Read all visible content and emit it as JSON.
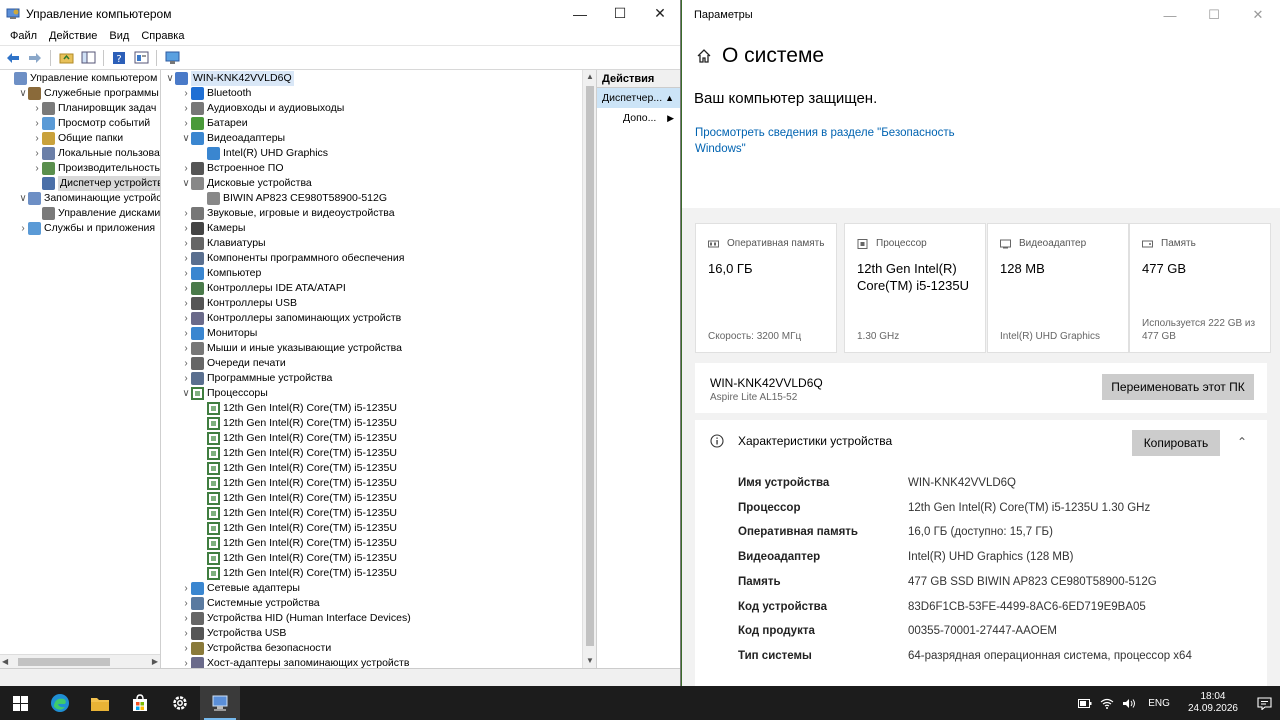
{
  "cm": {
    "title": "Управление компьютером",
    "menu": [
      "Файл",
      "Действие",
      "Вид",
      "Справка"
    ],
    "tree": [
      {
        "label": "Управление компьютером (лс",
        "level": 0,
        "tw": "",
        "sel": false
      },
      {
        "label": "Служебные программы",
        "level": 1,
        "tw": "v",
        "sel": false
      },
      {
        "label": "Планировщик задач",
        "level": 2,
        "tw": ">",
        "sel": false
      },
      {
        "label": "Просмотр событий",
        "level": 2,
        "tw": ">",
        "sel": false
      },
      {
        "label": "Общие папки",
        "level": 2,
        "tw": ">",
        "sel": false
      },
      {
        "label": "Локальные пользовате",
        "level": 2,
        "tw": ">",
        "sel": false
      },
      {
        "label": "Производительность",
        "level": 2,
        "tw": ">",
        "sel": false
      },
      {
        "label": "Диспетчер устройств",
        "level": 2,
        "tw": "",
        "sel": true
      },
      {
        "label": "Запоминающие устройств",
        "level": 1,
        "tw": "v",
        "sel": false
      },
      {
        "label": "Управление дисками",
        "level": 2,
        "tw": "",
        "sel": false
      },
      {
        "label": "Службы и приложения",
        "level": 1,
        "tw": ">",
        "sel": false
      }
    ],
    "devices": [
      {
        "label": "WIN-KNK42VVLD6Q",
        "level": 0,
        "tw": "v",
        "icon": "computer"
      },
      {
        "label": "Bluetooth",
        "level": 1,
        "tw": ">",
        "icon": "bluetooth"
      },
      {
        "label": "Аудиовходы и аудиовыходы",
        "level": 1,
        "tw": ">",
        "icon": "speaker"
      },
      {
        "label": "Батареи",
        "level": 1,
        "tw": ">",
        "icon": "battery"
      },
      {
        "label": "Видеоадаптеры",
        "level": 1,
        "tw": "v",
        "icon": "display"
      },
      {
        "label": "Intel(R) UHD Graphics",
        "level": 2,
        "tw": "",
        "icon": "display"
      },
      {
        "label": "Встроенное ПО",
        "level": 1,
        "tw": ">",
        "icon": "chip"
      },
      {
        "label": "Дисковые устройства",
        "level": 1,
        "tw": "v",
        "icon": "disk"
      },
      {
        "label": "BIWIN AP823 CE980T58900-512G",
        "level": 2,
        "tw": "",
        "icon": "disk"
      },
      {
        "label": "Звуковые, игровые и видеоустройства",
        "level": 1,
        "tw": ">",
        "icon": "speaker"
      },
      {
        "label": "Камеры",
        "level": 1,
        "tw": ">",
        "icon": "camera"
      },
      {
        "label": "Клавиатуры",
        "level": 1,
        "tw": ">",
        "icon": "keyboard"
      },
      {
        "label": "Компоненты программного обеспечения",
        "level": 1,
        "tw": ">",
        "icon": "component"
      },
      {
        "label": "Компьютер",
        "level": 1,
        "tw": ">",
        "icon": "monitor"
      },
      {
        "label": "Контроллеры IDE ATA/ATAPI",
        "level": 1,
        "tw": ">",
        "icon": "controller"
      },
      {
        "label": "Контроллеры USB",
        "level": 1,
        "tw": ">",
        "icon": "usb"
      },
      {
        "label": "Контроллеры запоминающих устройств",
        "level": 1,
        "tw": ">",
        "icon": "storage"
      },
      {
        "label": "Мониторы",
        "level": 1,
        "tw": ">",
        "icon": "monitor"
      },
      {
        "label": "Мыши и иные указывающие устройства",
        "level": 1,
        "tw": ">",
        "icon": "mouse"
      },
      {
        "label": "Очереди печати",
        "level": 1,
        "tw": ">",
        "icon": "printer"
      },
      {
        "label": "Программные устройства",
        "level": 1,
        "tw": ">",
        "icon": "component"
      },
      {
        "label": "Процессоры",
        "level": 1,
        "tw": "v",
        "icon": "cpu"
      },
      {
        "label": "12th Gen Intel(R) Core(TM) i5-1235U",
        "level": 2,
        "tw": "",
        "icon": "cpu"
      },
      {
        "label": "12th Gen Intel(R) Core(TM) i5-1235U",
        "level": 2,
        "tw": "",
        "icon": "cpu"
      },
      {
        "label": "12th Gen Intel(R) Core(TM) i5-1235U",
        "level": 2,
        "tw": "",
        "icon": "cpu"
      },
      {
        "label": "12th Gen Intel(R) Core(TM) i5-1235U",
        "level": 2,
        "tw": "",
        "icon": "cpu"
      },
      {
        "label": "12th Gen Intel(R) Core(TM) i5-1235U",
        "level": 2,
        "tw": "",
        "icon": "cpu"
      },
      {
        "label": "12th Gen Intel(R) Core(TM) i5-1235U",
        "level": 2,
        "tw": "",
        "icon": "cpu"
      },
      {
        "label": "12th Gen Intel(R) Core(TM) i5-1235U",
        "level": 2,
        "tw": "",
        "icon": "cpu"
      },
      {
        "label": "12th Gen Intel(R) Core(TM) i5-1235U",
        "level": 2,
        "tw": "",
        "icon": "cpu"
      },
      {
        "label": "12th Gen Intel(R) Core(TM) i5-1235U",
        "level": 2,
        "tw": "",
        "icon": "cpu"
      },
      {
        "label": "12th Gen Intel(R) Core(TM) i5-1235U",
        "level": 2,
        "tw": "",
        "icon": "cpu"
      },
      {
        "label": "12th Gen Intel(R) Core(TM) i5-1235U",
        "level": 2,
        "tw": "",
        "icon": "cpu"
      },
      {
        "label": "12th Gen Intel(R) Core(TM) i5-1235U",
        "level": 2,
        "tw": "",
        "icon": "cpu"
      },
      {
        "label": "Сетевые адаптеры",
        "level": 1,
        "tw": ">",
        "icon": "network"
      },
      {
        "label": "Системные устройства",
        "level": 1,
        "tw": ">",
        "icon": "system"
      },
      {
        "label": "Устройства HID (Human Interface Devices)",
        "level": 1,
        "tw": ">",
        "icon": "hid"
      },
      {
        "label": "Устройства USB",
        "level": 1,
        "tw": ">",
        "icon": "usb"
      },
      {
        "label": "Устройства безопасности",
        "level": 1,
        "tw": ">",
        "icon": "security"
      },
      {
        "label": "Хост-адаптеры запоминающих устройств",
        "level": 1,
        "tw": ">",
        "icon": "storage"
      }
    ],
    "actions": {
      "header": "Действия",
      "item1": "Диспетчер...",
      "item2": "Допо..."
    }
  },
  "settings": {
    "title": "Параметры",
    "page_title": "О системе",
    "protected": "Ваш компьютер защищен.",
    "security_link": "Просмотреть сведения в разделе \"Безопасность Windows\"",
    "cards": [
      {
        "label": "Оперативная память",
        "value": "16,0 ГБ",
        "sub": "Скорость: 3200 МГц",
        "icon": "ram-icon"
      },
      {
        "label": "Процессор",
        "value": "12th Gen Intel(R) Core(TM) i5-1235U",
        "sub": "1.30 GHz",
        "icon": "cpu-icon"
      },
      {
        "label": "Видеоадаптер",
        "value": "128 MB",
        "sub": "Intel(R) UHD Graphics",
        "icon": "gpu-icon"
      },
      {
        "label": "Память",
        "value": "477 GB",
        "sub": "Используется 222 GB из 477 GB",
        "icon": "storage-icon"
      }
    ],
    "device_name": "WIN-KNK42VVLD6Q",
    "device_model": "Aspire Lite AL15-52",
    "rename_button": "Переименовать этот ПК",
    "specs_title": "Характеристики устройства",
    "copy_button": "Копировать",
    "specs": [
      {
        "k": "Имя устройства",
        "v": "WIN-KNK42VVLD6Q"
      },
      {
        "k": "Процессор",
        "v": "12th Gen Intel(R) Core(TM) i5-1235U   1.30 GHz"
      },
      {
        "k": "Оперативная память",
        "v": "16,0 ГБ (доступно: 15,7 ГБ)"
      },
      {
        "k": "Видеоадаптер",
        "v": "Intel(R) UHD Graphics (128 MB)"
      },
      {
        "k": "Память",
        "v": "477 GB SSD BIWIN AP823 CE980T58900-512G"
      },
      {
        "k": "Код устройства",
        "v": "83D6F1CB-53FE-4499-8AC6-6ED719E9BA05"
      },
      {
        "k": "Код продукта",
        "v": "00355-70001-27447-AAOEM"
      },
      {
        "k": "Тип системы",
        "v": "64-разрядная операционная система, процессор x64"
      }
    ]
  },
  "taskbar": {
    "lang": "ENG",
    "time": "18:04",
    "date": "24.09.2026"
  },
  "colors": {
    "accent": "#0063b1",
    "taskbar": "#1c1c1c"
  }
}
